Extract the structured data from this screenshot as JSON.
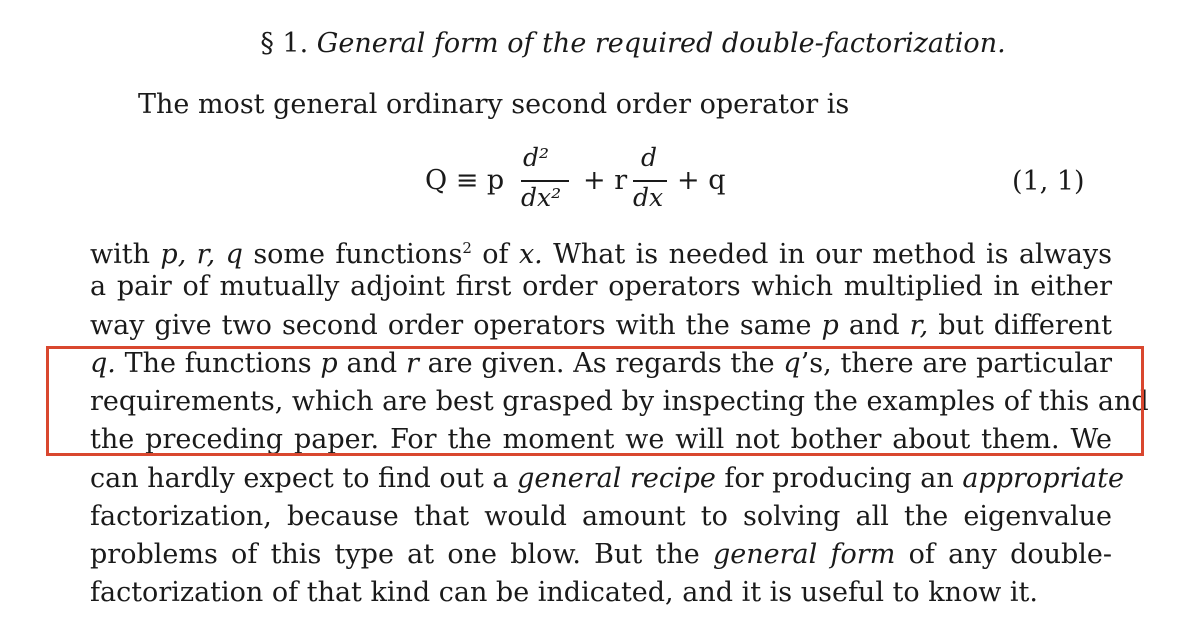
{
  "section": {
    "number": "§ 1.",
    "title": "General form of the required double-factorization."
  },
  "intro": "The most general ordinary second order operator is",
  "equation": {
    "lhs": "Q ≡ p",
    "d2_num": "d²",
    "d2_den": "dx²",
    "plus1": "+ r",
    "d_num": "d",
    "d_den": "dx",
    "plus2": "+ q",
    "label": "(1, 1)"
  },
  "lines": [
    {
      "parts": [
        {
          "t": "with "
        },
        {
          "t": "p, r, q",
          "i": true
        },
        {
          "t": " some functions"
        },
        {
          "t": "2",
          "sup": true
        },
        {
          "t": " of "
        },
        {
          "t": "x.",
          "i": true
        },
        {
          "t": "  What is needed in our method is always"
        }
      ]
    },
    {
      "parts": [
        {
          "t": "a pair of mutually adjoint first order operators which multiplied in either"
        }
      ]
    },
    {
      "parts": [
        {
          "t": "way give two second order operators with the same "
        },
        {
          "t": "p",
          "i": true
        },
        {
          "t": " and "
        },
        {
          "t": "r,",
          "i": true
        },
        {
          "t": " but different"
        }
      ]
    },
    {
      "parts": [
        {
          "t": "q.",
          "i": true
        },
        {
          "t": "  The functions "
        },
        {
          "t": "p",
          "i": true
        },
        {
          "t": " and "
        },
        {
          "t": "r",
          "i": true
        },
        {
          "t": " are given.  As regards the "
        },
        {
          "t": "q",
          "i": true
        },
        {
          "t": "’s, there are particular"
        }
      ]
    },
    {
      "parts": [
        {
          "t": "requirements, which are best grasped by inspecting the examples of this and"
        }
      ]
    },
    {
      "parts": [
        {
          "t": "the preceding paper.  For the moment we will not bother about them.  We"
        }
      ]
    },
    {
      "parts": [
        {
          "t": "can hardly expect to find out a "
        },
        {
          "t": "general recipe",
          "i": true
        },
        {
          "t": " for producing an "
        },
        {
          "t": "appropriate",
          "i": true
        }
      ]
    },
    {
      "parts": [
        {
          "t": "factorization, because that would amount to solving all the eigenvalue"
        }
      ]
    },
    {
      "parts": [
        {
          "t": "problems of this type at one blow.  But the "
        },
        {
          "t": "general form",
          "i": true
        },
        {
          "t": " of any double-"
        }
      ]
    },
    {
      "parts": [
        {
          "t": "factorization of that kind can be indicated, and it is useful to know it."
        }
      ]
    }
  ],
  "highlight_color": "#d9472f"
}
